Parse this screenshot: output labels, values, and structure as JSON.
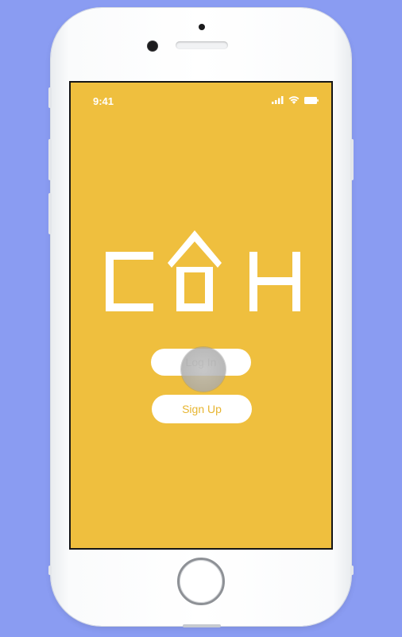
{
  "colors": {
    "background": "#8a9cf2",
    "screen": "#efbf3e",
    "accent_text": "#e7b531",
    "logo": "#ffffff"
  },
  "status_bar": {
    "time": "9:41",
    "icons": [
      "signal-icon",
      "wifi-icon",
      "battery-icon"
    ]
  },
  "logo": {
    "text": "COH"
  },
  "buttons": {
    "login_label": "Log In",
    "signup_label": "Sign Up"
  }
}
